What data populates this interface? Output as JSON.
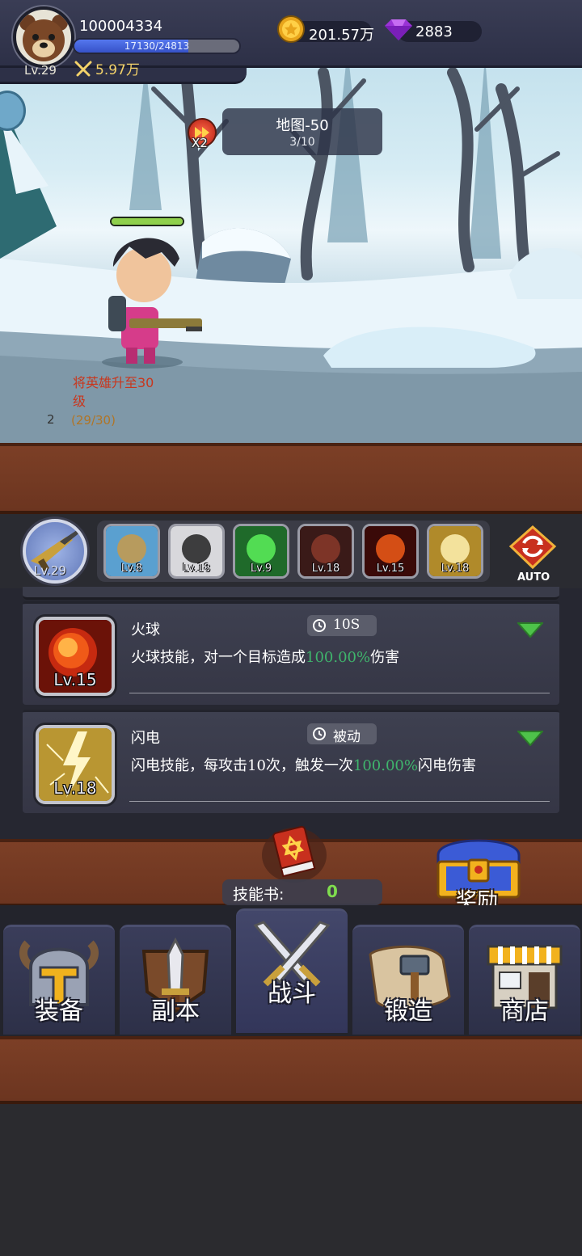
{
  "player": {
    "id": "100004334",
    "level": "Lv.29",
    "xp_text": "17130/24813",
    "xp_fraction": 0.69,
    "power": "5.97万"
  },
  "currency": {
    "gold": "201.57万",
    "gems": "2883"
  },
  "battle": {
    "speed_label": "X2",
    "map_name": "地图-50",
    "wave": "3/10",
    "hero_hp_fraction": 1.0
  },
  "quest": {
    "title": "将英雄升至30级",
    "reward_count": "2",
    "progress": "(29/30)"
  },
  "skill_bar": {
    "weapon_level": "Lv.29",
    "slots": [
      {
        "level": "Lv.8",
        "icon": "sniper-icon"
      },
      {
        "level": "Lv.18",
        "icon": "bomb-skull-icon"
      },
      {
        "level": "Lv.9",
        "icon": "green-heal-icon"
      },
      {
        "level": "Lv.18",
        "icon": "bear-summon-icon"
      },
      {
        "level": "Lv.15",
        "icon": "fireball-icon"
      },
      {
        "level": "Lv.18",
        "icon": "lightning-icon"
      }
    ],
    "auto_label": "AUTO"
  },
  "skills": [
    {
      "name": "火球",
      "level": "Lv.15",
      "cooldown": "10S",
      "desc_before": "火球技能，对一个目标造成",
      "desc_pct": "100.00%",
      "desc_after": "伤害",
      "icon": "fireball-icon"
    },
    {
      "name": "闪电",
      "level": "Lv.18",
      "cooldown": "被动",
      "desc_before": "闪电技能，每攻击10次，触发一次",
      "desc_pct": "100.00%",
      "desc_after": "闪电伤害",
      "icon": "lightning-icon"
    }
  ],
  "skill_book": {
    "label": "技能书:",
    "value": "0"
  },
  "reward": {
    "label": "奖励"
  },
  "nav": {
    "tabs": [
      {
        "label": "装备",
        "icon": "helmet-icon"
      },
      {
        "label": "副本",
        "icon": "sword-shield-icon"
      },
      {
        "label": "战斗",
        "icon": "crossed-swords-icon"
      },
      {
        "label": "锻造",
        "icon": "scroll-hammer-icon"
      },
      {
        "label": "商店",
        "icon": "shop-icon"
      }
    ],
    "active": "战斗"
  },
  "colors": {
    "wood": "#7c3f26",
    "panel": "#353645",
    "accent_green": "#3fb46c",
    "gold_text": "#f4d36a"
  }
}
